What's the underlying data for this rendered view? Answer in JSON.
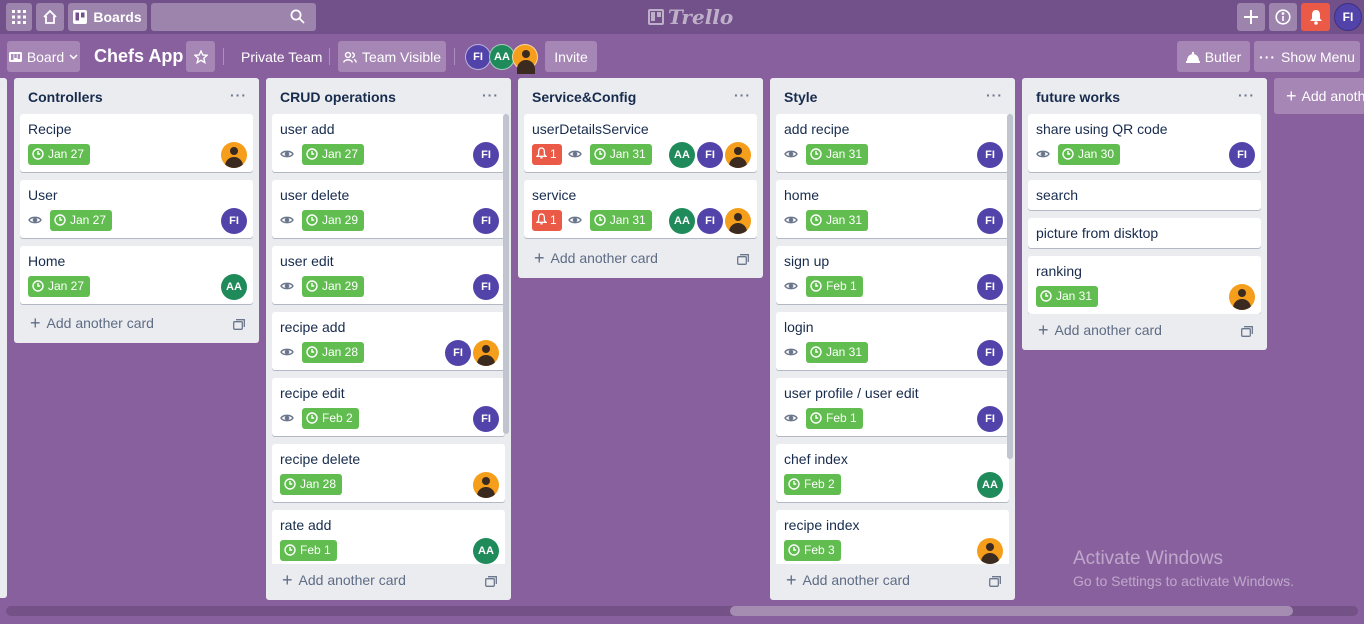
{
  "header": {
    "boards_label": "Boards",
    "logo_text": "Trello",
    "search_placeholder": "",
    "user_initials": "FI"
  },
  "board": {
    "view_label": "Board",
    "title": "Chefs App",
    "team_label": "Private Team",
    "visibility_label": "Team Visible",
    "members": [
      "FI",
      "AA",
      ""
    ],
    "invite_label": "Invite",
    "butler_label": "Butler",
    "show_menu_label": "Show Menu",
    "add_list_label": "Add anoth"
  },
  "lists": [
    {
      "title": "Controllers",
      "add_label": "Add another card",
      "cards": [
        {
          "title": "Recipe",
          "watch": false,
          "notif": "",
          "due": "Jan 27",
          "members": [
            "photo"
          ]
        },
        {
          "title": "User",
          "watch": true,
          "notif": "",
          "due": "Jan 27",
          "members": [
            "FI"
          ]
        },
        {
          "title": "Home",
          "watch": false,
          "notif": "",
          "due": "Jan 27",
          "members": [
            "AA"
          ]
        }
      ]
    },
    {
      "title": "CRUD operations",
      "add_label": "Add another card",
      "cards": [
        {
          "title": "user add",
          "watch": true,
          "notif": "",
          "due": "Jan 27",
          "members": [
            "FI"
          ]
        },
        {
          "title": "user delete",
          "watch": true,
          "notif": "",
          "due": "Jan 29",
          "members": [
            "FI"
          ]
        },
        {
          "title": "user edit",
          "watch": true,
          "notif": "",
          "due": "Jan 29",
          "members": [
            "FI"
          ]
        },
        {
          "title": "recipe add",
          "watch": true,
          "notif": "",
          "due": "Jan 28",
          "members": [
            "FI",
            "photo"
          ]
        },
        {
          "title": "recipe edit",
          "watch": true,
          "notif": "",
          "due": "Feb 2",
          "members": [
            "FI"
          ]
        },
        {
          "title": "recipe delete",
          "watch": false,
          "notif": "",
          "due": "Jan 28",
          "members": [
            "photo"
          ]
        },
        {
          "title": "rate add",
          "watch": false,
          "notif": "",
          "due": "Feb 1",
          "members": [
            "AA"
          ]
        }
      ]
    },
    {
      "title": "Service&Config",
      "add_label": "Add another card",
      "cards": [
        {
          "title": "userDetailsService",
          "watch": true,
          "notif": "1",
          "due": "Jan 31",
          "members": [
            "AA",
            "FI",
            "photo"
          ]
        },
        {
          "title": "service",
          "watch": true,
          "notif": "1",
          "due": "Jan 31",
          "members": [
            "AA",
            "FI",
            "photo"
          ]
        }
      ]
    },
    {
      "title": "Style",
      "add_label": "Add another card",
      "cards": [
        {
          "title": "add recipe",
          "watch": true,
          "notif": "",
          "due": "Jan 31",
          "members": [
            "FI"
          ]
        },
        {
          "title": "home",
          "watch": true,
          "notif": "",
          "due": "Jan 31",
          "members": [
            "FI"
          ]
        },
        {
          "title": "sign up",
          "watch": true,
          "notif": "",
          "due": "Feb 1",
          "members": [
            "FI"
          ]
        },
        {
          "title": "login",
          "watch": true,
          "notif": "",
          "due": "Jan 31",
          "members": [
            "FI"
          ]
        },
        {
          "title": "user profile / user edit",
          "watch": true,
          "notif": "",
          "due": "Feb 1",
          "members": [
            "FI"
          ]
        },
        {
          "title": "chef index",
          "watch": false,
          "notif": "",
          "due": "Feb 2",
          "members": [
            "AA"
          ]
        },
        {
          "title": "recipe index",
          "watch": false,
          "notif": "",
          "due": "Feb 3",
          "members": [
            "photo"
          ]
        }
      ]
    },
    {
      "title": "future works",
      "add_label": "Add another card",
      "cards": [
        {
          "title": "share using QR code",
          "watch": true,
          "notif": "",
          "due": "Jan 30",
          "members": [
            "FI"
          ]
        },
        {
          "title": "search",
          "watch": false,
          "notif": "",
          "due": "",
          "members": []
        },
        {
          "title": "picture from disktop",
          "watch": false,
          "notif": "",
          "due": "",
          "members": []
        },
        {
          "title": "ranking",
          "watch": false,
          "notif": "",
          "due": "Jan 31",
          "members": [
            "photo"
          ]
        }
      ]
    }
  ],
  "watermark": {
    "line1": "Activate Windows",
    "line2": "Go to Settings to activate Windows."
  },
  "colors": {
    "background": "#89609e",
    "due_green": "#61bd4f",
    "notif_red": "#eb5a46",
    "avatar_fi": "#5243aa",
    "avatar_aa": "#1f8a5a"
  }
}
